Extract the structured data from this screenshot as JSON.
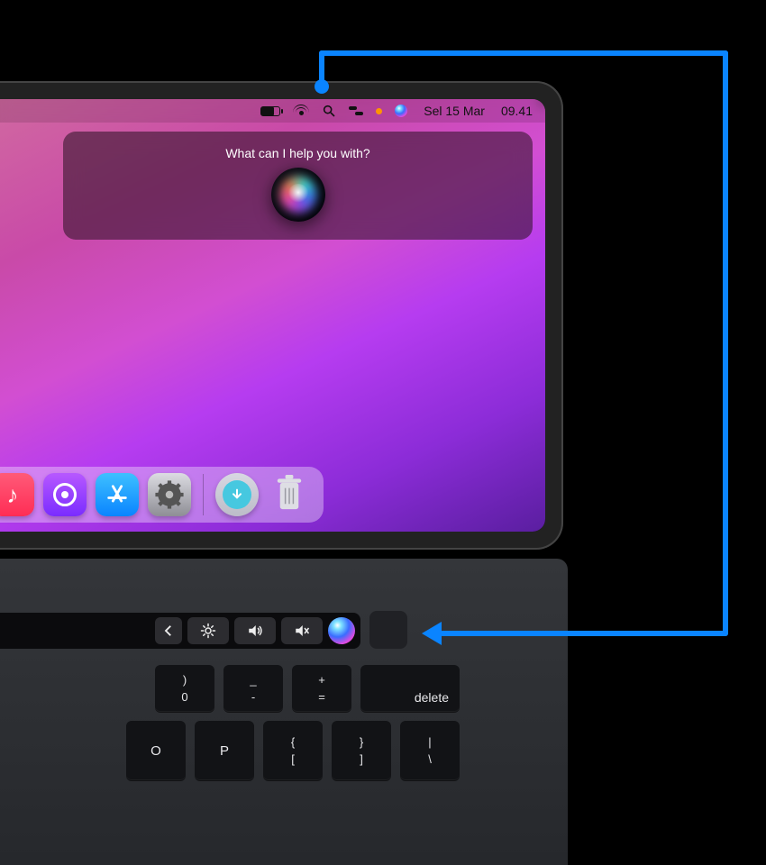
{
  "menubar": {
    "date": "Sel 15 Mar",
    "time": "09.41"
  },
  "siri": {
    "prompt": "What can I help you with?"
  },
  "keys": {
    "delete": "delete",
    "backslash_top": "|",
    "backslash_bot": "\\",
    "plus_top": "+",
    "plus_bot": "=",
    "minus_top": "_",
    "minus_bot": "-",
    "zero_top": ")",
    "zero_bot": "0",
    "brR_top": "}",
    "brR_bot": "]",
    "brL_top": "{",
    "brL_bot": "[",
    "p_top": "P",
    "o_top": "O"
  }
}
